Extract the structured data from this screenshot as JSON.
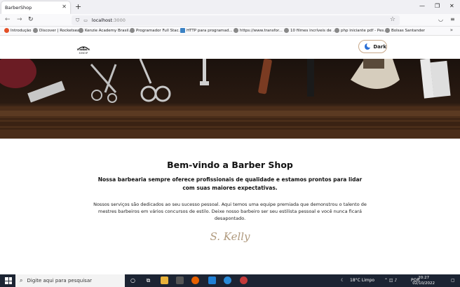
{
  "browser": {
    "tab_title": "BarberShop",
    "tab_close": "✕",
    "new_tab": "+",
    "url_host": "localhost",
    "url_port": ":3000",
    "window_minimize": "—",
    "window_maximize": "❐",
    "window_close": "✕"
  },
  "bookmarks": [
    {
      "label": "Introdução",
      "color": "#e34f26"
    },
    {
      "label": "Discover | Rocketseat",
      "color": "#666"
    },
    {
      "label": "Kenzie Academy Brasil...",
      "color": "#666"
    },
    {
      "label": "Programador Full Stac...",
      "color": "#666"
    },
    {
      "label": "HTTP para programad...",
      "color": "#3b82c4"
    },
    {
      "label": "https://www.transfor...",
      "color": "#666"
    },
    {
      "label": "10 filmes incríveis de ...",
      "color": "#666"
    },
    {
      "label": "php iniciante pdf - Pes...",
      "color": "#666"
    },
    {
      "label": "Bolsas Santander",
      "color": "#666"
    }
  ],
  "header": {
    "logo_text": "BARBER SHOP",
    "dark_button_label": "Dark"
  },
  "main": {
    "title": "Bem-vindo a Barber Shop",
    "lead": "Nossa barbearia sempre oferece profissionais de qualidade e estamos prontos para lidar com suas maiores expectativas.",
    "body": "Nossos serviços são dedicados ao seu sucesso pessoal. Aqui temos uma equipe premiada que demonstrou o talento de mestres barbeiros em vários concursos de estilo. Deixe nosso barbeiro ser seu estilista pessoal e você nunca ficará desapontado.",
    "signature": "S. Kelly"
  },
  "taskbar": {
    "search_placeholder": "Digite aqui para pesquisar",
    "weather": "18°C  Limpo",
    "language": "POR",
    "time": "20:27",
    "date": "02/10/2022"
  }
}
